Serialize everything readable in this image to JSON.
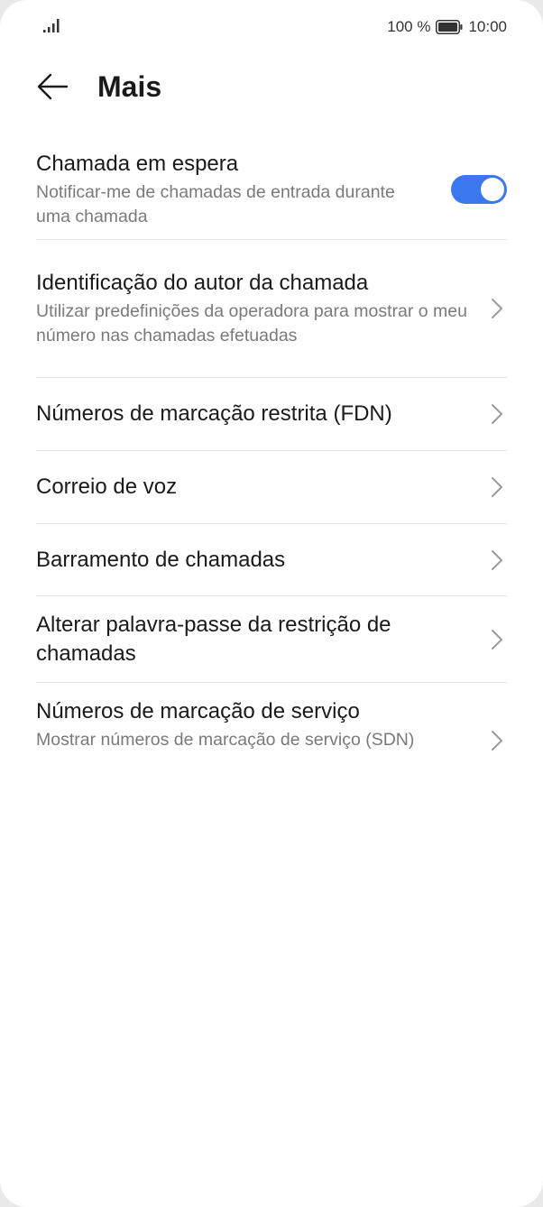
{
  "status_bar": {
    "battery_percent": "100 %",
    "time": "10:00",
    "icons": [
      "signal-icon",
      "battery-icon"
    ]
  },
  "header": {
    "title": "Mais",
    "back_icon": "back-arrow-icon"
  },
  "settings": {
    "call_waiting": {
      "title": "Chamada em espera",
      "subtitle": "Notificar-me de chamadas de entrada durante uma chamada",
      "toggle_on": true,
      "toggle_color": "#3b78f0"
    },
    "caller_id": {
      "title": "Identificação do autor da chamada",
      "subtitle": "Utilizar predefinições da operadora para mostrar o meu número nas chamadas efetuadas"
    },
    "fdn": {
      "title": "Números de marcação restrita (FDN)"
    },
    "voicemail": {
      "title": "Correio de voz"
    },
    "call_barring": {
      "title": "Barramento de chamadas"
    },
    "barring_password": {
      "title": "Alterar palavra-passe da restrição de chamadas"
    },
    "sdn": {
      "title": "Números de marcação de serviço",
      "subtitle": "Mostrar números de marcação de serviço (SDN)"
    }
  }
}
